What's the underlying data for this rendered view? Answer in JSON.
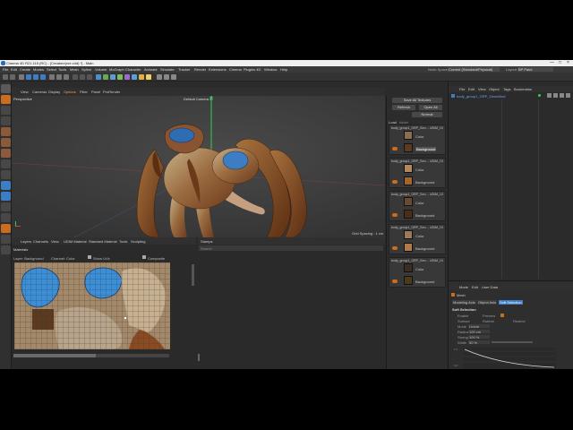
{
  "window": {
    "title": "Cinema 4D R21.115 (RC) - [Creature(cre.c4d) *] - Main",
    "buttons": [
      "—",
      "□",
      "×"
    ]
  },
  "menubar": {
    "items": [
      "File",
      "Edit",
      "Create",
      "Modes",
      "Select",
      "Tools",
      "Mesh",
      "Spline",
      "Volume",
      "MoGraph",
      "Character",
      "Animate",
      "Simulate",
      "Tracker",
      "Render",
      "Extensions",
      "Cinema",
      "Plugins 4D",
      "Window",
      "Help"
    ],
    "node_space_label": "Node Space",
    "node_space_value": "Current (Standard/Physical)",
    "layout_label": "Layout",
    "layout_value": "BP Paint"
  },
  "viewport": {
    "menu": [
      "View",
      "Cameras",
      "Display",
      "Options",
      "Filter",
      "Panel",
      "ProRender"
    ],
    "label": "Perspective",
    "camera": "Default Camera •○",
    "grid_spacing": "Grid Spacing : 1 cm"
  },
  "texture_panel": {
    "tabs": [
      "Layers",
      "Channels",
      "View",
      "UDIM Material",
      "Standard Material",
      "Tools",
      "Sculpting"
    ],
    "header": "Materials",
    "layer_label": "Layer: Background",
    "channel_label": "Channel: Color",
    "show_uvs": "Show UVs",
    "composite": "Composite"
  },
  "stamps_panel": {
    "tab": "Stamps",
    "search_placeholder": "Search"
  },
  "material_list": {
    "sync_button": "Save All Textures",
    "refresh_button": "Refresh",
    "open_all_button": "Open All",
    "normal_value": "Normal",
    "load_label": "Load",
    "folder_label": "folder",
    "materials": [
      {
        "name": "body_group1_GRP_Geo… UDIM_10",
        "layers": [
          "Color",
          "Background"
        ]
      },
      {
        "name": "body_group1_GRP_Geo… UDIM_10",
        "layers": [
          "Color",
          "Background"
        ]
      },
      {
        "name": "body_group1_GRP_Geo… UDIM_10",
        "layers": [
          "Color",
          "Background"
        ]
      },
      {
        "name": "body_group1_GRP_Geo… UDIM_10",
        "layers": [
          "Color",
          "Background"
        ]
      },
      {
        "name": "body_group1_GRP_Geo… UDIM_10",
        "layers": [
          "Color",
          "Background"
        ]
      }
    ]
  },
  "object_manager": {
    "menu": [
      "File",
      "Edit",
      "View",
      "Object",
      "Tags",
      "Bookmarks"
    ],
    "object": "body_group1_GRP_GeomBod"
  },
  "attributes": {
    "menu": [
      "Mode",
      "Edit",
      "User Data"
    ],
    "mode": "Mesh",
    "tabs": [
      "Modeling Axis",
      "Object Axis",
      "Soft Selection"
    ],
    "section": "Soft Selection",
    "rows": [
      {
        "label": "Enable",
        "value": ""
      },
      {
        "label": "Surface",
        "value": "Rubber"
      },
      {
        "label": "Restrict",
        "value": ""
      },
      {
        "label": "Mode",
        "value": "Linear"
      },
      {
        "label": "Radius",
        "value": "100 cm"
      },
      {
        "label": "Strength",
        "value": "100 %"
      },
      {
        "label": "Width",
        "value": "50 %"
      }
    ],
    "graph_y_ticks": [
      "1.0",
      "0.8",
      "0.6",
      "0.4",
      "0.2",
      "0.0"
    ],
    "graph_x_ticks": [
      "0.0",
      "0.2",
      "0.4",
      "0.6",
      "0.8",
      "1.0"
    ]
  },
  "colors": {
    "accent": "#3c7dc4",
    "active_orange": "#c96d1e",
    "panel": "#2b2b2b"
  }
}
